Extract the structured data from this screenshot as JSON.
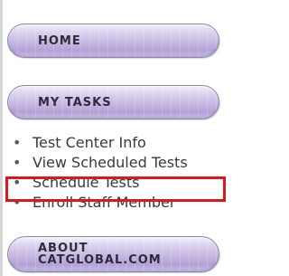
{
  "nav": {
    "home_label": "HOME",
    "my_tasks_label": "MY TASKS",
    "about_line1": "ABOUT",
    "about_line2": "CATGLOBAL.COM"
  },
  "tasks": {
    "bullet": "•",
    "items": [
      "Test Center Info",
      "View Scheduled Tests",
      "Schedule Tests",
      "Enroll Staff Member"
    ]
  },
  "colors": {
    "button_fill": "#c6b7e2",
    "button_text": "#2f2b3b",
    "highlight": "#e0161c"
  }
}
